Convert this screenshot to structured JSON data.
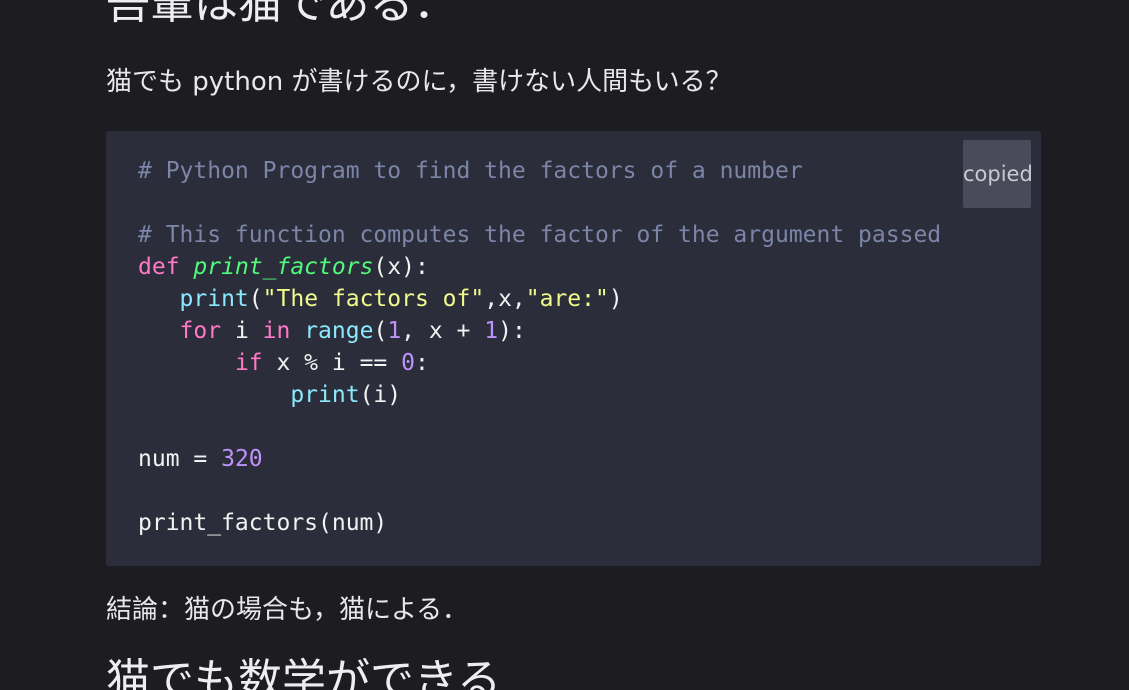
{
  "article": {
    "top_heading": "吾輩は猫である．",
    "intro_paragraph": "猫でも python が書けるのに，書けない人間もいる？",
    "conclusion_paragraph": "結論：猫の場合も，猫による．",
    "bottom_heading": "猫でも数学ができる"
  },
  "code_block": {
    "language": "python",
    "copy_button_label": "copied",
    "background_color": "#2b2d3a",
    "lines": [
      {
        "tokens": [
          {
            "t": "# Python Program to find the factors of a number",
            "c": "cmt"
          }
        ]
      },
      {
        "tokens": []
      },
      {
        "tokens": [
          {
            "t": "# This function computes the factor of the argument passed",
            "c": "cmt"
          }
        ]
      },
      {
        "tokens": [
          {
            "t": "def",
            "c": "kw"
          },
          {
            "t": " ",
            "c": ""
          },
          {
            "t": "print_factors",
            "c": "fn-def"
          },
          {
            "t": "(x):",
            "c": ""
          }
        ]
      },
      {
        "tokens": [
          {
            "t": "   ",
            "c": ""
          },
          {
            "t": "print",
            "c": "builtin"
          },
          {
            "t": "(",
            "c": ""
          },
          {
            "t": "\"The factors of\"",
            "c": "str"
          },
          {
            "t": ",x,",
            "c": ""
          },
          {
            "t": "\"are:\"",
            "c": "str"
          },
          {
            "t": ")",
            "c": ""
          }
        ]
      },
      {
        "tokens": [
          {
            "t": "   ",
            "c": ""
          },
          {
            "t": "for",
            "c": "kw"
          },
          {
            "t": " i ",
            "c": ""
          },
          {
            "t": "in",
            "c": "kw"
          },
          {
            "t": " ",
            "c": ""
          },
          {
            "t": "range",
            "c": "builtin"
          },
          {
            "t": "(",
            "c": ""
          },
          {
            "t": "1",
            "c": "num"
          },
          {
            "t": ", x + ",
            "c": ""
          },
          {
            "t": "1",
            "c": "num"
          },
          {
            "t": "):",
            "c": ""
          }
        ]
      },
      {
        "tokens": [
          {
            "t": "       ",
            "c": ""
          },
          {
            "t": "if",
            "c": "kw"
          },
          {
            "t": " x % i == ",
            "c": ""
          },
          {
            "t": "0",
            "c": "num"
          },
          {
            "t": ":",
            "c": ""
          }
        ]
      },
      {
        "tokens": [
          {
            "t": "           ",
            "c": ""
          },
          {
            "t": "print",
            "c": "builtin"
          },
          {
            "t": "(i)",
            "c": ""
          }
        ]
      },
      {
        "tokens": []
      },
      {
        "tokens": [
          {
            "t": "num = ",
            "c": ""
          },
          {
            "t": "320",
            "c": "num"
          }
        ]
      },
      {
        "tokens": []
      },
      {
        "tokens": [
          {
            "t": "print_factors(num)",
            "c": ""
          }
        ]
      }
    ]
  }
}
